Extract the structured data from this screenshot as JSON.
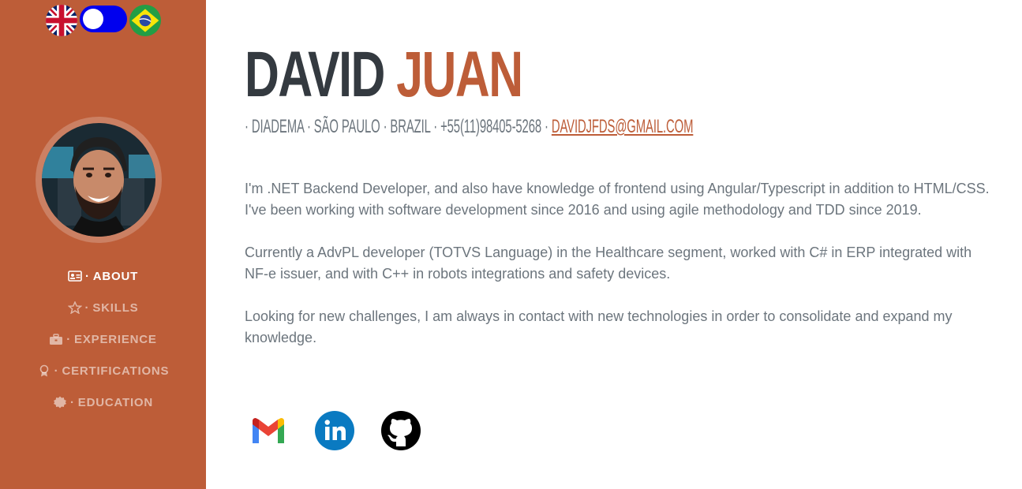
{
  "language": {
    "left_flag": "uk-flag-icon",
    "right_flag": "brazil-flag-icon",
    "toggle_state": "english"
  },
  "sidebar": {
    "background": "#bd5d38",
    "nav": [
      {
        "label": "ABOUT",
        "icon": "id-card-icon",
        "active": true
      },
      {
        "label": "SKILLS",
        "icon": "star-icon",
        "active": false
      },
      {
        "label": "EXPERIENCE",
        "icon": "briefcase-icon",
        "active": false
      },
      {
        "label": "CERTIFICATIONS",
        "icon": "award-icon",
        "active": false
      },
      {
        "label": "EDUCATION",
        "icon": "certificate-seal-icon",
        "active": false
      }
    ]
  },
  "header": {
    "first_name": "DAVID",
    "last_name": "JUAN",
    "location": "· DIADEMA · SÃO PAULO · BRAZIL · +55(11)98405-5268 ·",
    "email": "DAVIDJFDS@GMAIL.COM"
  },
  "bio": [
    "I'm .NET Backend Developer, and also have knowledge of frontend using Angular/Typescript in addition to HTML/CSS. I've been working with software development since 2016 and using agile methodology and TDD since 2019.",
    "Currently a AdvPL developer (TOTVS Language) in the Healthcare segment, worked with C# in ERP integrated with NF-e issuer, and with C++ in robots integrations and safety devices.",
    "Looking for new challenges, I am always in contact with new technologies in order to consolidate and expand my knowledge."
  ],
  "social": [
    "gmail-icon",
    "linkedin-icon",
    "github-icon"
  ],
  "colors": {
    "accent": "#bd5d38",
    "heading": "#343a40",
    "text": "#6c757d",
    "toggle": "#0000ee"
  }
}
